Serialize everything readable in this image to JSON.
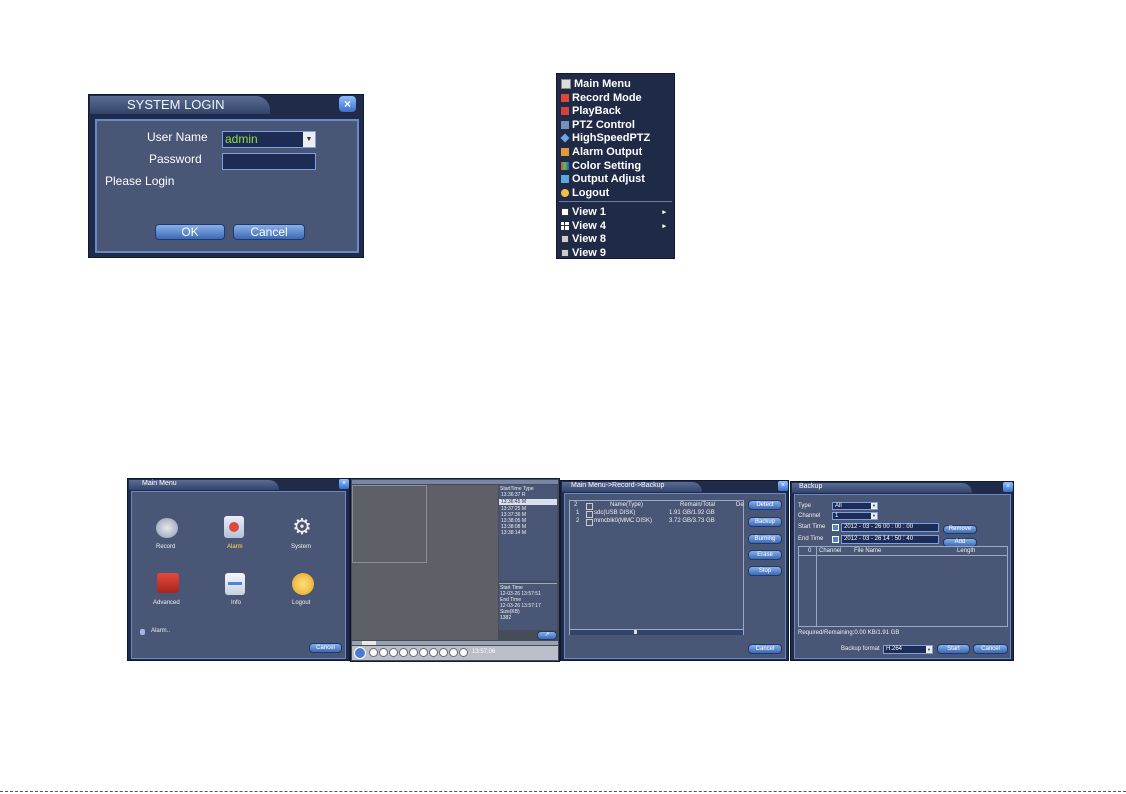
{
  "login": {
    "title": "SYSTEM LOGIN",
    "user_label": "User Name",
    "user_value": "admin",
    "password_label": "Password",
    "status": "Please Login",
    "ok": "OK",
    "cancel": "Cancel"
  },
  "context_menu": {
    "items": [
      "Main Menu",
      "Record Mode",
      "PlayBack",
      "PTZ Control",
      "HighSpeedPTZ",
      "Alarm Output",
      "Color Setting",
      "Output Adjust",
      "Logout"
    ],
    "views": [
      "View 1",
      "View 4",
      "View 8",
      "View 9"
    ]
  },
  "main_menu": {
    "title": "Main Menu",
    "icons": [
      "Record",
      "Alarm",
      "System",
      "Advanced",
      "Info",
      "Logout"
    ],
    "alarm_text": "Alarm..",
    "cancel": "Cancel"
  },
  "playback": {
    "list_header": "StartTime Type",
    "rows": [
      "13:36:37 R",
      "13:36:45 M",
      "13:37:25 M",
      "13:37:36 M",
      "13:38:05 M",
      "13:38:08 M",
      "13:38:14 M"
    ],
    "info": [
      "Start Time",
      "12-03-26 13:57:51",
      "End Time",
      "12-03-26 13:57:17",
      "Size(KB)",
      "1382"
    ],
    "time": "13:57:06"
  },
  "backup_panel": {
    "title": "Main Menu->Record->Backup",
    "headers": [
      "2",
      "Name(Type)",
      "Remain/Total",
      "De"
    ],
    "rows": [
      {
        "num": "1",
        "name": "sdc(USB DISK)",
        "size": "1.91 GB/1.92 GB"
      },
      {
        "num": "2",
        "name": "mmcblk0(MMC DISK)",
        "size": "3.72 GB/3.73 GB"
      }
    ],
    "buttons": [
      "Detect",
      "Backup",
      "Burning",
      "Erase",
      "Stop",
      "Cancel"
    ]
  },
  "backup_dialog": {
    "title": "Backup",
    "type_label": "Type",
    "type_value": "All",
    "channel_label": "Channel",
    "channel_value": "1",
    "start_label": "Start Time",
    "start_value": "2012 - 03 - 26  00 : 00 : 00",
    "end_label": "End Time",
    "end_value": "2012 - 03 - 26  14 : 50 : 40",
    "remove": "Remove",
    "add": "Add",
    "table_headers": [
      "0",
      "Channel",
      "File Name",
      "Length"
    ],
    "required": "Required/Remaining:0.00 KB/1.91 GB",
    "format_label": "Backup format",
    "format_value": "H.264",
    "start_btn": "Start",
    "cancel_btn": "Cancel"
  },
  "colors": {
    "panel": "#4a5676",
    "accent": "#3d69b6",
    "field_text": "#8fdf3a"
  }
}
